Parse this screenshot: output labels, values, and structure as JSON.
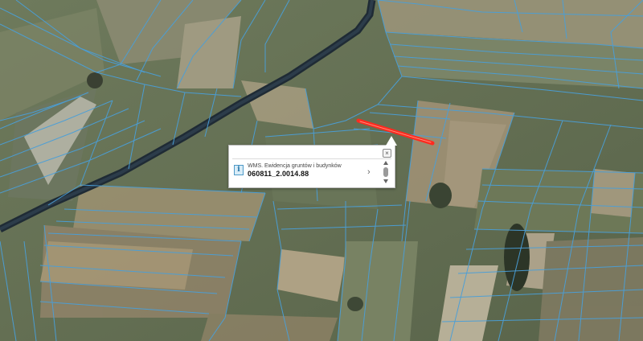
{
  "map": {
    "type": "aerial imagery with cadastral parcel boundaries",
    "parcel_line_color": "#4a9fd8",
    "highlight_color": "#ff2a1f",
    "road_color": "#1f2b35"
  },
  "popup": {
    "layer_name": "WMS. Ewidencja gruntów i budynków",
    "parcel_id": "060811_2.0014.88",
    "close_glyph": "×",
    "next_glyph": "›",
    "info_icon": "info-icon"
  }
}
